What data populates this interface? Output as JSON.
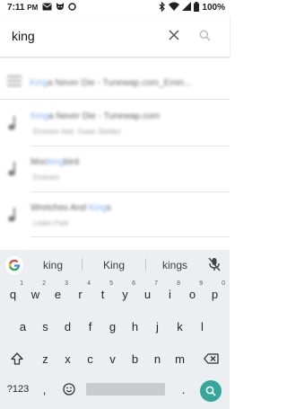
{
  "status_bar": {
    "time": "7:11",
    "time_suffix": "PM",
    "battery": "100%"
  },
  "search": {
    "query": "king",
    "placeholder": ""
  },
  "results": {
    "header": {
      "highlight": "King",
      "title_rest": "a Never Die - Tunewap.com_Emin..."
    },
    "songs": [
      {
        "title_before": "",
        "highlight": "King",
        "title_after": "a Never Die - Tunewap.com",
        "artist": "Eminem feat. Gwen Stefani"
      },
      {
        "title_before": "Moc",
        "highlight": "king",
        "title_after": "bird",
        "artist": "Eminem"
      },
      {
        "title_before": "Wretches And ",
        "highlight": "King",
        "title_after": "s",
        "artist": "Linkin Park"
      }
    ]
  },
  "keyboard": {
    "suggestions": [
      "king",
      "King",
      "kings"
    ],
    "row1": [
      {
        "key": "q",
        "hint": "1"
      },
      {
        "key": "w",
        "hint": "2"
      },
      {
        "key": "e",
        "hint": "3"
      },
      {
        "key": "r",
        "hint": "4"
      },
      {
        "key": "t",
        "hint": "5"
      },
      {
        "key": "y",
        "hint": "6"
      },
      {
        "key": "u",
        "hint": "7"
      },
      {
        "key": "i",
        "hint": "8"
      },
      {
        "key": "o",
        "hint": "9"
      },
      {
        "key": "p",
        "hint": "0"
      }
    ],
    "row2": [
      "a",
      "s",
      "d",
      "f",
      "g",
      "h",
      "j",
      "k",
      "l"
    ],
    "row3": [
      "z",
      "x",
      "c",
      "v",
      "b",
      "n",
      "m"
    ],
    "symbols_label": "?123",
    "comma": ",",
    "period": ".",
    "colors": {
      "background": "#eceff1",
      "enter": "#34a89b",
      "highlight": "#7fb2ee"
    }
  }
}
